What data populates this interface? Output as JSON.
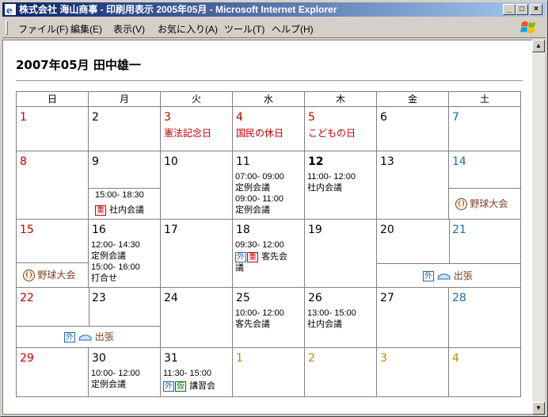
{
  "window": {
    "title": "株式会社 海山商事 - 印刷用表示 2005年05月 - Microsoft Internet Explorer",
    "buttons": {
      "minimize": "_",
      "maximize": "□",
      "close": "×"
    }
  },
  "menu": [
    "ファイル(F)",
    "編集(E)",
    "表示(V)",
    "お気に入り(A)",
    "ツール(T)",
    "ヘルプ(H)"
  ],
  "page": {
    "title": "2007年05月 田中雄一"
  },
  "weekdays": [
    "日",
    "月",
    "火",
    "水",
    "木",
    "金",
    "土"
  ],
  "days": {
    "d1": "1",
    "d2": "2",
    "d3": "3",
    "d4": "4",
    "d5": "5",
    "d6": "6",
    "d7": "7",
    "d8": "8",
    "d9": "9",
    "d10": "10",
    "d11": "11",
    "d12": "12",
    "d13": "13",
    "d14": "14",
    "d15": "15",
    "d16": "16",
    "d17": "17",
    "d18": "18",
    "d19": "19",
    "d20": "20",
    "d21": "21",
    "d22": "22",
    "d23": "23",
    "d24": "24",
    "d25": "25",
    "d26": "26",
    "d27": "27",
    "d28": "28",
    "d29": "29",
    "d30": "30",
    "d31": "31",
    "n1": "1",
    "n2": "2",
    "n3": "3",
    "n4": "4"
  },
  "holidays": {
    "d3": "憲法記念日",
    "d4": "国民の休日",
    "d5": "こどもの日"
  },
  "events": {
    "d9": {
      "time": "15:00- 18:30",
      "tag": "重",
      "title": "社内会議"
    },
    "d11": [
      {
        "time": "07:00- 09:00",
        "title": "定例会議"
      },
      {
        "time": "09:00- 11:00",
        "title": "定例会議"
      }
    ],
    "d12": {
      "time": "11:00- 12:00",
      "title": "社内会議"
    },
    "d14": {
      "title": "野球大会"
    },
    "d15": {
      "title": "野球大会"
    },
    "d16": [
      {
        "time": "12:00- 14:30",
        "title": "定例会議"
      },
      {
        "time": "15:00- 16:00",
        "title": "打合せ"
      }
    ],
    "d18": {
      "time": "09:30- 12:00",
      "tag1": "外",
      "tag2": "重",
      "title1": "客先会",
      "title2": "議"
    },
    "d20": {
      "tag": "外",
      "title": "出張"
    },
    "d22": {
      "tag": "外",
      "title": "出張"
    },
    "d25": {
      "time": "10:00- 12:00",
      "title": "客先会議"
    },
    "d26": {
      "time": "13:00- 15:00",
      "title": "社内会議"
    },
    "d30": {
      "time": "10:00- 12:00",
      "title": "定例会議"
    },
    "d31": {
      "time": "11:30- 15:00",
      "tag1": "外",
      "tag2": "仮",
      "title": "講習会"
    }
  }
}
